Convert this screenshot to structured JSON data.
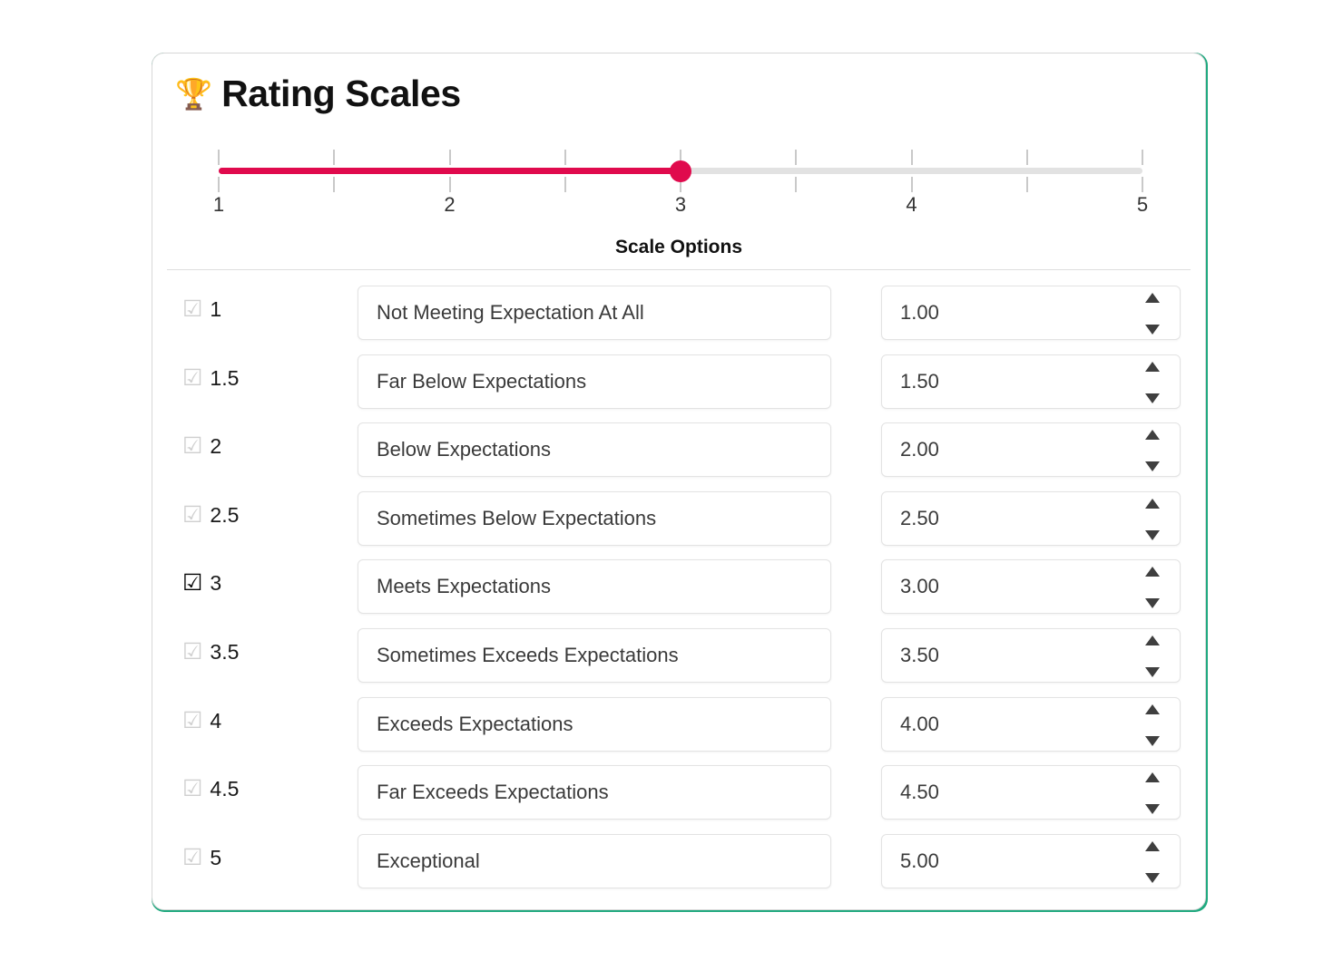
{
  "card": {
    "title": "Rating Scales",
    "trophy_icon": "trophy-icon",
    "accent_color": "#1fa97f",
    "border_color": "#d7d7d7"
  },
  "slider": {
    "min": 1,
    "max": 5,
    "step": 0.5,
    "value": 3,
    "fill_color": "#e00a4d",
    "track_color": "#e2e2e2",
    "tick_values": [
      1,
      1.5,
      2,
      2.5,
      3,
      3.5,
      4,
      4.5,
      5
    ],
    "labels": [
      {
        "text": "1",
        "value": 1
      },
      {
        "text": "2",
        "value": 2
      },
      {
        "text": "3",
        "value": 3
      },
      {
        "text": "4",
        "value": 4
      },
      {
        "text": "5",
        "value": 5
      }
    ]
  },
  "section": {
    "heading": "Scale Options"
  },
  "options": [
    {
      "checked": false,
      "rating": "1",
      "label": "Not Meeting Expectation At All",
      "value": "1.00"
    },
    {
      "checked": false,
      "rating": "1.5",
      "label": "Far Below Expectations",
      "value": "1.50"
    },
    {
      "checked": false,
      "rating": "2",
      "label": "Below Expectations",
      "value": "2.00"
    },
    {
      "checked": false,
      "rating": "2.5",
      "label": "Sometimes Below Expectations",
      "value": "2.50"
    },
    {
      "checked": true,
      "rating": "3",
      "label": "Meets Expectations",
      "value": "3.00"
    },
    {
      "checked": false,
      "rating": "3.5",
      "label": "Sometimes Exceeds Expectations",
      "value": "3.50"
    },
    {
      "checked": false,
      "rating": "4",
      "label": "Exceeds Expectations",
      "value": "4.00"
    },
    {
      "checked": false,
      "rating": "4.5",
      "label": "Far Exceeds Expectations",
      "value": "4.50"
    },
    {
      "checked": false,
      "rating": "5",
      "label": "Exceptional",
      "value": "5.00"
    }
  ],
  "glyphs": {
    "checkbox_checked": "☑",
    "trophy": "🏆"
  }
}
